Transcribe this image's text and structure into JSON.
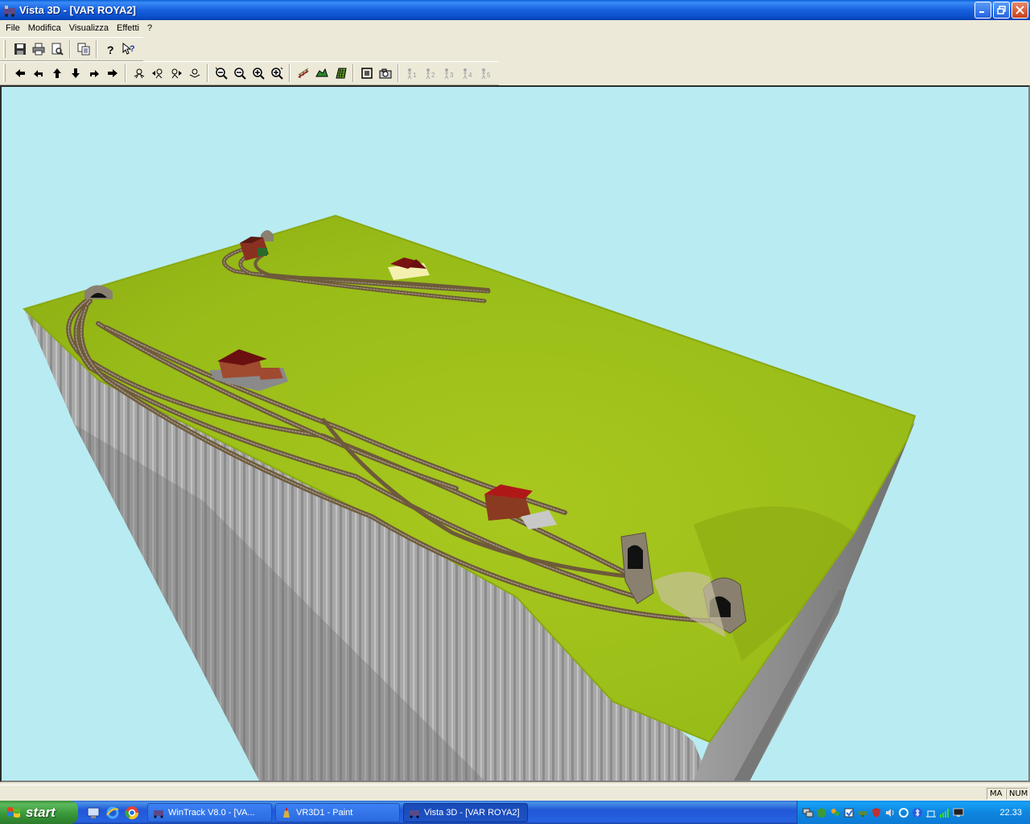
{
  "window": {
    "title": "Vista 3D - [VAR ROYA2]"
  },
  "menu": {
    "items": [
      "File",
      "Modifica",
      "Visualizza",
      "Effetti",
      "?"
    ]
  },
  "toolbar1": {
    "icons": [
      "save-icon",
      "print-icon",
      "print-preview-icon",
      "copy-icon",
      "help-icon",
      "context-help-icon"
    ]
  },
  "toolbar2": {
    "icons": [
      "arrow-left-icon",
      "rotate-left-icon",
      "arrow-up-icon",
      "arrow-down-icon",
      "rotate-right-icon",
      "arrow-right-icon",
      "camera-tilt-up-icon",
      "camera-left-icon",
      "camera-right-icon",
      "camera-tilt-down-icon",
      "zoom-out-far-icon",
      "zoom-out-icon",
      "zoom-in-icon",
      "zoom-in-near-icon",
      "track-icon",
      "terrain-icon",
      "grid-icon",
      "fit-view-icon",
      "snapshot-icon",
      "viewpoint-1-icon",
      "viewpoint-2-icon",
      "viewpoint-3-icon",
      "viewpoint-4-icon",
      "viewpoint-5-icon"
    ],
    "viewpoint_labels": [
      "1",
      "2",
      "3",
      "4",
      "5"
    ]
  },
  "scene": {
    "sky_color": "#b8ecf2",
    "terrain_color": "#9fc21c",
    "cliff_color": "#9a9a9a"
  },
  "statusbar": {
    "caps": "MA",
    "num": "NUM"
  },
  "taskbar": {
    "start_label": "start",
    "tasks": [
      {
        "label": "WinTrack  V8.0 - [VA...",
        "active": false
      },
      {
        "label": "VR3D1 - Paint",
        "active": false
      },
      {
        "label": "Vista 3D - [VAR ROYA2]",
        "active": true
      }
    ],
    "clock": "22.33"
  }
}
